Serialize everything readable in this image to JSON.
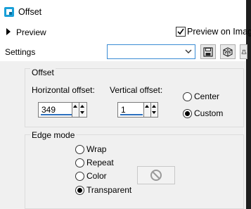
{
  "window": {
    "title": "Offset",
    "icon": "offset-app-icon"
  },
  "preview": {
    "label": "Preview",
    "preview_on_image_label": "Preview on Image",
    "preview_on_image_checked": true
  },
  "settings": {
    "label": "Settings",
    "value": "",
    "toolbar_icons": [
      "save-icon",
      "cube-icon",
      "stamp-icon"
    ]
  },
  "offset": {
    "group_label": "Offset",
    "horizontal_label": "Horizontal offset:",
    "horizontal_value": "349",
    "vertical_label": "Vertical offset:",
    "vertical_value": "1",
    "modes": [
      {
        "label": "Center",
        "selected": false
      },
      {
        "label": "Custom",
        "selected": true
      }
    ]
  },
  "edge_mode": {
    "group_label": "Edge mode",
    "options": [
      {
        "label": "Wrap",
        "selected": false
      },
      {
        "label": "Repeat",
        "selected": false
      },
      {
        "label": "Color",
        "selected": false
      },
      {
        "label": "Transparent",
        "selected": true
      }
    ],
    "color_swatch_icon": "no-color-icon"
  },
  "colors": {
    "accent": "#2b6fbf",
    "panel": "#f0f0f0",
    "title_icon": "#1aa0d8"
  }
}
